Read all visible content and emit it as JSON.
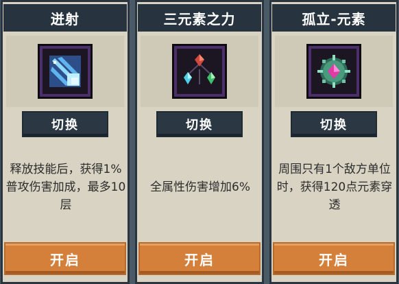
{
  "cards": [
    {
      "title": "迸射",
      "icon": "burst-arrows-icon",
      "switch_label": "切换",
      "description": "释放技能后，获得1%普攻伤害加成，最多10层",
      "enable_label": "开启"
    },
    {
      "title": "三元素之力",
      "icon": "three-element-gems-icon",
      "switch_label": "切换",
      "description": "全属性伤害增加6%",
      "enable_label": "开启"
    },
    {
      "title": "孤立-元素",
      "icon": "isolated-element-icon",
      "switch_label": "切换",
      "description": "周围只有1个敌方单位时，获得120点元素穿透",
      "enable_label": "开启"
    }
  ],
  "colors": {
    "title_bar": "#27343f",
    "card_bg": "#d8d3c3",
    "switch_button": "#2b3844",
    "enable_button": "#d4803a"
  }
}
